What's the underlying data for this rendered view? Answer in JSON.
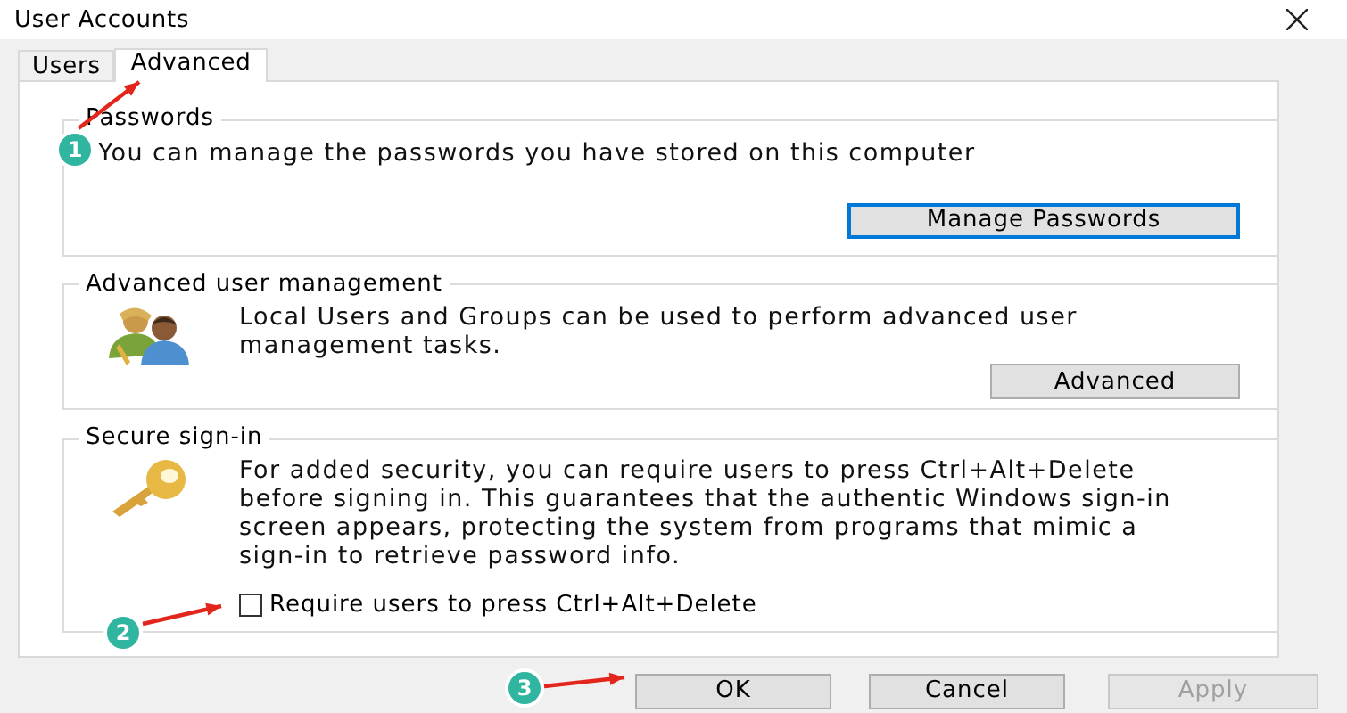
{
  "window": {
    "title": "User Accounts"
  },
  "tabs": [
    {
      "label": "Users",
      "selected": false
    },
    {
      "label": "Advanced",
      "selected": true
    }
  ],
  "groups": [
    {
      "kind": "text",
      "title": "Passwords",
      "text": "You can manage the passwords you have stored on this computer",
      "button": {
        "label": "Manage Passwords",
        "focused": true
      }
    },
    {
      "kind": "users",
      "title": "Advanced user management",
      "text": "Local Users and Groups can be used to perform advanced user management tasks.",
      "button": {
        "label": "Advanced",
        "focused": false
      }
    },
    {
      "kind": "key",
      "title": "Secure sign-in",
      "text": "For added security, you can require users to press Ctrl+Alt+Delete before signing in. This guarantees that the authentic Windows sign-in screen appears, protecting the system from programs that mimic a sign-in to retrieve password info.",
      "checkbox": {
        "label": "Require users to press Ctrl+Alt+Delete",
        "checked": false
      }
    }
  ],
  "buttons": [
    {
      "label": "OK",
      "disabled": false
    },
    {
      "label": "Cancel",
      "disabled": false
    },
    {
      "label": "Apply",
      "disabled": true
    }
  ],
  "annotations": [
    {
      "label": "1"
    },
    {
      "label": "2"
    },
    {
      "label": "3"
    }
  ]
}
